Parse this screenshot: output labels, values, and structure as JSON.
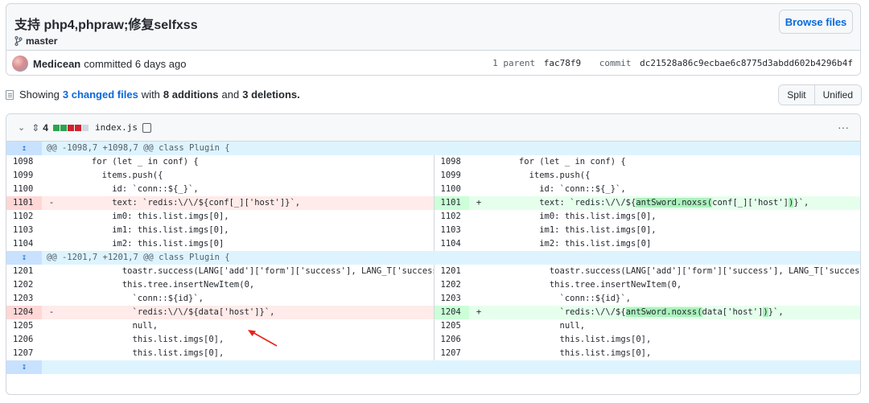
{
  "commit": {
    "title": "支持 php4,phpraw;修复selfxss",
    "branch": "master",
    "browse_label": "Browse files",
    "author": "Medicean",
    "committed_text": "committed 6 days ago",
    "parent_label": "1 parent",
    "parent_sha": "fac78f9",
    "commit_label": "commit",
    "commit_sha": "dc21528a86c9ecbae6c8775d3abdd602b4296b4f"
  },
  "summary": {
    "showing": "Showing",
    "changed_files": "3 changed files",
    "with": "with",
    "additions": "8 additions",
    "and": "and",
    "deletions": "3 deletions.",
    "split_label": "Split",
    "unified_label": "Unified"
  },
  "file": {
    "count": "4",
    "name": "index.js",
    "diffstat_colors": [
      "#2da44e",
      "#2da44e",
      "#cf222e",
      "#cf222e",
      "#d0d7de"
    ],
    "menu": "···"
  },
  "hunks": [
    {
      "header": "@@ -1098,7 +1098,7 @@ class Plugin {",
      "expand_icon": "expand-up-icon",
      "rows": [
        {
          "type": "ctx",
          "ln": "1098",
          "rn": "1098",
          "l": "      for (let _ in conf) {",
          "r": "      for (let _ in conf) {"
        },
        {
          "type": "ctx",
          "ln": "1099",
          "rn": "1099",
          "l": "        items.push({",
          "r": "        items.push({"
        },
        {
          "type": "ctx",
          "ln": "1100",
          "rn": "1100",
          "l": "          id: `conn::${_}`,",
          "r": "          id: `conn::${_}`,"
        },
        {
          "type": "chg",
          "ln": "1101",
          "rn": "1101",
          "l": "          text: `redis:\\/\\/${conf[_]['host']}`,",
          "r_pre": "          text: `redis:\\/\\/${",
          "r_hl": "antSword.noxss(",
          "r_mid": "conf[_]['host']",
          "r_hl2": ")",
          "r_post": "}`,"
        },
        {
          "type": "ctx",
          "ln": "1102",
          "rn": "1102",
          "l": "          im0: this.list.imgs[0],",
          "r": "          im0: this.list.imgs[0],"
        },
        {
          "type": "ctx",
          "ln": "1103",
          "rn": "1103",
          "l": "          im1: this.list.imgs[0],",
          "r": "          im1: this.list.imgs[0],"
        },
        {
          "type": "ctx",
          "ln": "1104",
          "rn": "1104",
          "l": "          im2: this.list.imgs[0]",
          "r": "          im2: this.list.imgs[0]"
        }
      ]
    },
    {
      "header": "@@ -1201,7 +1201,7 @@ class Plugin {",
      "expand_icon": "expand-both-icon",
      "rows": [
        {
          "type": "ctx",
          "ln": "1201",
          "rn": "1201",
          "l": "            toastr.success(LANG['add']['form']['success'], LANG_T['success']);",
          "r": "            toastr.success(LANG['add']['form']['success'], LANG_T['success']);"
        },
        {
          "type": "ctx",
          "ln": "1202",
          "rn": "1202",
          "l": "            this.tree.insertNewItem(0,",
          "r": "            this.tree.insertNewItem(0,"
        },
        {
          "type": "ctx",
          "ln": "1203",
          "rn": "1203",
          "l": "              `conn::${id}`,",
          "r": "              `conn::${id}`,"
        },
        {
          "type": "chg",
          "ln": "1204",
          "rn": "1204",
          "l": "              `redis:\\/\\/${data['host']}`,",
          "r_pre": "              `redis:\\/\\/${",
          "r_hl": "antSword.noxss(",
          "r_mid": "data['host']",
          "r_hl2": ")",
          "r_post": "}`,"
        },
        {
          "type": "ctx",
          "ln": "1205",
          "rn": "1205",
          "l": "              null,",
          "r": "              null,"
        },
        {
          "type": "ctx",
          "ln": "1206",
          "rn": "1206",
          "l": "              this.list.imgs[0],",
          "r": "              this.list.imgs[0],"
        },
        {
          "type": "ctx",
          "ln": "1207",
          "rn": "1207",
          "l": "              this.list.imgs[0],",
          "r": "              this.list.imgs[0],"
        }
      ]
    }
  ],
  "markers": {
    "del": "-",
    "add": "+"
  },
  "annotation_color": "#e5231b"
}
